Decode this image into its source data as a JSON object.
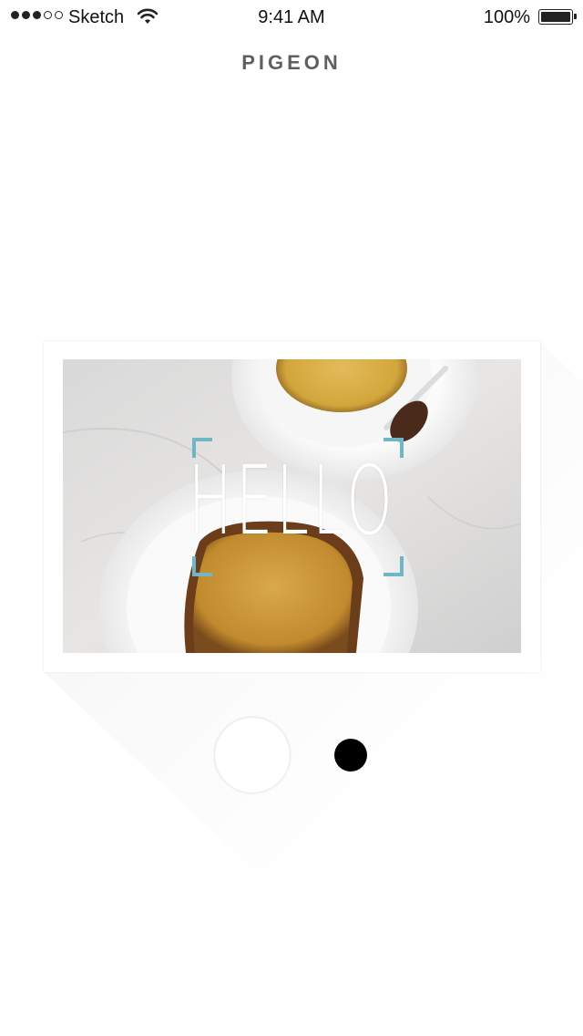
{
  "status_bar": {
    "carrier": "Sketch",
    "time": "9:41 AM",
    "battery_percent": "100%",
    "signal_bars_filled": 3,
    "signal_bars_total": 5
  },
  "header": {
    "title": "PIGEON"
  },
  "card": {
    "overlay_text": "HELLO",
    "frame_color": "#6fb7c4",
    "photo_description_icon": "photo-toast-coffee-image"
  },
  "pager": {
    "pages": 2,
    "current": 1
  },
  "colors": {
    "title": "#5f5f5f",
    "background": "#ffffff",
    "accent": "#6fb7c4"
  }
}
